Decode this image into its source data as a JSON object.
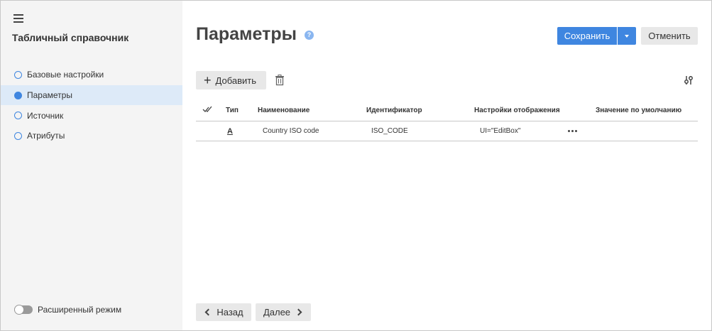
{
  "sidebar": {
    "title": "Табличный справочник",
    "items": [
      {
        "label": "Базовые настройки",
        "active": false
      },
      {
        "label": "Параметры",
        "active": true
      },
      {
        "label": "Источник",
        "active": false
      },
      {
        "label": "Атрибуты",
        "active": false
      }
    ],
    "advanced_mode_label": "Расширенный режим",
    "advanced_mode_on": false
  },
  "header": {
    "title": "Параметры",
    "help_icon": "?",
    "save_label": "Сохранить",
    "cancel_label": "Отменить"
  },
  "toolbar": {
    "add_label": "Добавить",
    "icons": [
      "plus-icon",
      "trash-icon",
      "settings-sliders-icon"
    ]
  },
  "table": {
    "columns": [
      "Тип",
      "Наименование",
      "Идентификатор",
      "Настройки отображения",
      "Значение по умолчанию"
    ],
    "rows": [
      {
        "type": "A",
        "name": "Country ISO code",
        "identifier": "ISO_CODE",
        "display_settings": "UI=\"EditBox\"",
        "default_value": ""
      }
    ]
  },
  "footer": {
    "back_label": "Назад",
    "next_label": "Далее"
  },
  "colors": {
    "accent": "#3f86e0",
    "sidebar_bg": "#f4f4f4",
    "active_item_bg": "#ddeaf8",
    "button_gray": "#e8e8e8"
  }
}
